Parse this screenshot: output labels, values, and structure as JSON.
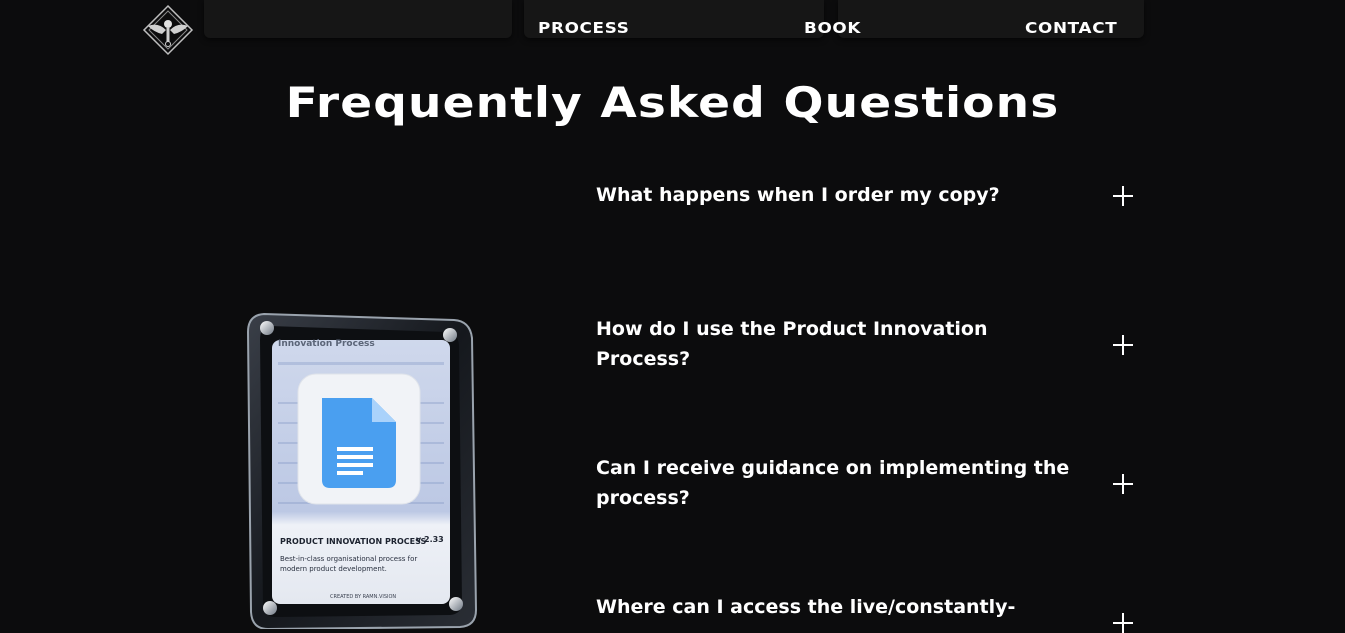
{
  "nav": {
    "logo_icon": "winged-emblem-icon",
    "links": [
      "PROCESS",
      "BOOK",
      "CONTACT"
    ]
  },
  "faq": {
    "title": "Frequently Asked Questions",
    "items": [
      {
        "question": "What happens when I order my copy?",
        "icon": "plus-icon"
      },
      {
        "question": "How do I use the Product Innovation Process?",
        "icon": "plus-icon"
      },
      {
        "question": "Can I receive guidance on implementing the process?",
        "icon": "plus-icon"
      },
      {
        "question": "Where can I access the live/constantly-",
        "icon": "plus-icon"
      }
    ]
  },
  "product_card": {
    "header_text": "Innovation Process",
    "app_icon": "google-docs-icon",
    "product_name": "PRODUCT INNOVATION PROCESS",
    "version": "v 2.33",
    "description_line1": "Best-in-class organisational process for",
    "description_line2": "modern product development.",
    "credit": "CREATED BY RAMN.VISION"
  },
  "colors": {
    "background": "#0c0c0d",
    "text": "#ffffff",
    "docs_blue": "#4a9ff0"
  }
}
